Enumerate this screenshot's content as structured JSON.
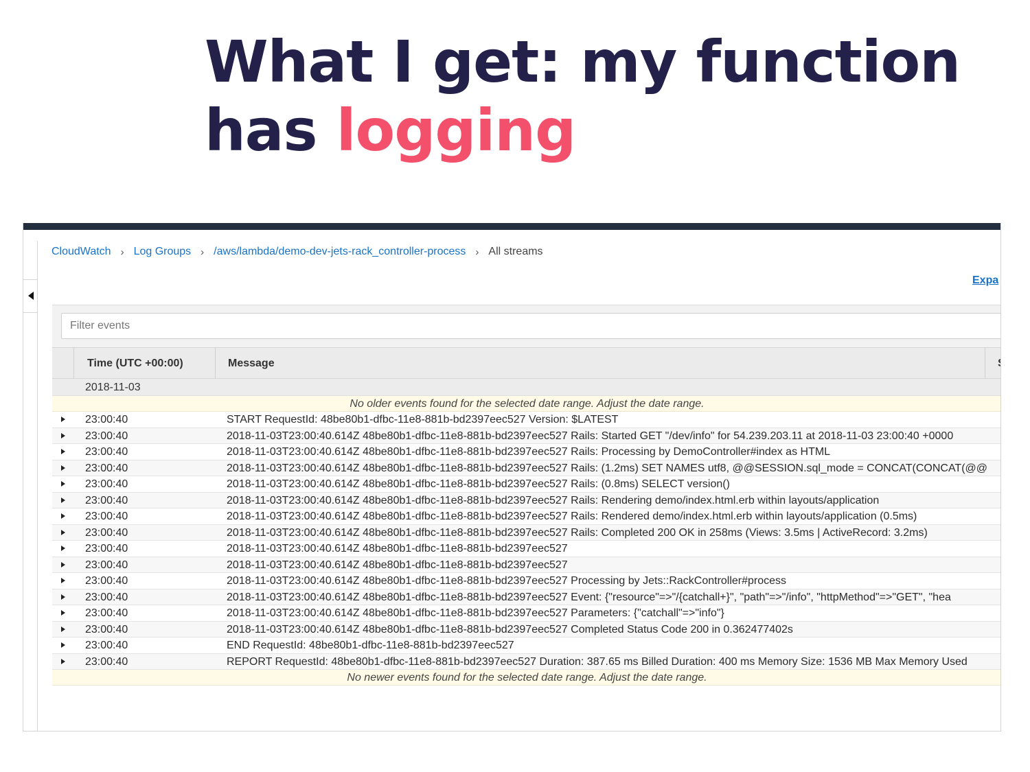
{
  "slide": {
    "title_part1": "What I get: my function has ",
    "title_accent": "logging",
    "colors": {
      "title": "#23204a",
      "accent": "#f2506b"
    }
  },
  "console": {
    "breadcrumb": [
      {
        "label": "CloudWatch",
        "link": true
      },
      {
        "label": "Log Groups",
        "link": true
      },
      {
        "label": "/aws/lambda/demo-dev-jets-rack_controller-process",
        "link": true
      },
      {
        "label": "All streams",
        "link": false
      }
    ],
    "breadcrumb_separator": "›",
    "expand_label": "Expa",
    "filter": {
      "placeholder": "Filter events",
      "value": ""
    },
    "columns": {
      "time": "Time (UTC +00:00)",
      "message": "Message",
      "trailing": "S"
    },
    "date_group": "2018-11-03",
    "notice_top": "No older events found for the selected date range. Adjust the date range.",
    "notice_bottom": "No newer events found for the selected date range. Adjust the date range.",
    "rows": [
      {
        "time": "23:00:40",
        "message": "START RequestId: 48be80b1-dfbc-11e8-881b-bd2397eec527 Version: $LATEST"
      },
      {
        "time": "23:00:40",
        "message": "2018-11-03T23:00:40.614Z 48be80b1-dfbc-11e8-881b-bd2397eec527 Rails: Started GET \"/dev/info\" for 54.239.203.11 at 2018-11-03 23:00:40 +0000"
      },
      {
        "time": "23:00:40",
        "message": "2018-11-03T23:00:40.614Z 48be80b1-dfbc-11e8-881b-bd2397eec527 Rails: Processing by DemoController#index as HTML"
      },
      {
        "time": "23:00:40",
        "message": "2018-11-03T23:00:40.614Z 48be80b1-dfbc-11e8-881b-bd2397eec527 Rails: (1.2ms) SET NAMES utf8, @@SESSION.sql_mode = CONCAT(CONCAT(@@"
      },
      {
        "time": "23:00:40",
        "message": "2018-11-03T23:00:40.614Z 48be80b1-dfbc-11e8-881b-bd2397eec527 Rails: (0.8ms) SELECT version()"
      },
      {
        "time": "23:00:40",
        "message": "2018-11-03T23:00:40.614Z 48be80b1-dfbc-11e8-881b-bd2397eec527 Rails: Rendering demo/index.html.erb within layouts/application"
      },
      {
        "time": "23:00:40",
        "message": "2018-11-03T23:00:40.614Z 48be80b1-dfbc-11e8-881b-bd2397eec527 Rails: Rendered demo/index.html.erb within layouts/application (0.5ms)"
      },
      {
        "time": "23:00:40",
        "message": "2018-11-03T23:00:40.614Z 48be80b1-dfbc-11e8-881b-bd2397eec527 Rails: Completed 200 OK in 258ms (Views: 3.5ms | ActiveRecord: 3.2ms)"
      },
      {
        "time": "23:00:40",
        "message": "2018-11-03T23:00:40.614Z 48be80b1-dfbc-11e8-881b-bd2397eec527"
      },
      {
        "time": "23:00:40",
        "message": "2018-11-03T23:00:40.614Z 48be80b1-dfbc-11e8-881b-bd2397eec527"
      },
      {
        "time": "23:00:40",
        "message": "2018-11-03T23:00:40.614Z 48be80b1-dfbc-11e8-881b-bd2397eec527 Processing by Jets::RackController#process"
      },
      {
        "time": "23:00:40",
        "message": "2018-11-03T23:00:40.614Z 48be80b1-dfbc-11e8-881b-bd2397eec527 Event: {\"resource\"=>\"/{catchall+}\", \"path\"=>\"/info\", \"httpMethod\"=>\"GET\", \"hea"
      },
      {
        "time": "23:00:40",
        "message": "2018-11-03T23:00:40.614Z 48be80b1-dfbc-11e8-881b-bd2397eec527 Parameters: {\"catchall\"=>\"info\"}"
      },
      {
        "time": "23:00:40",
        "message": "2018-11-03T23:00:40.614Z 48be80b1-dfbc-11e8-881b-bd2397eec527 Completed Status Code 200 in 0.362477402s"
      },
      {
        "time": "23:00:40",
        "message": "END RequestId: 48be80b1-dfbc-11e8-881b-bd2397eec527"
      },
      {
        "time": "23:00:40",
        "message": "REPORT RequestId: 48be80b1-dfbc-11e8-881b-bd2397eec527 Duration: 387.65 ms Billed Duration: 400 ms Memory Size: 1536 MB Max Memory Used"
      }
    ],
    "colors": {
      "topbar": "#232f3e",
      "link": "#1a73c8",
      "notice_bg": "#fffbe6"
    },
    "icons": {
      "collapse": "triangle-left-icon",
      "row_expander": "triangle-right-icon",
      "breadcrumb_sep": "chevron-right-icon"
    }
  }
}
